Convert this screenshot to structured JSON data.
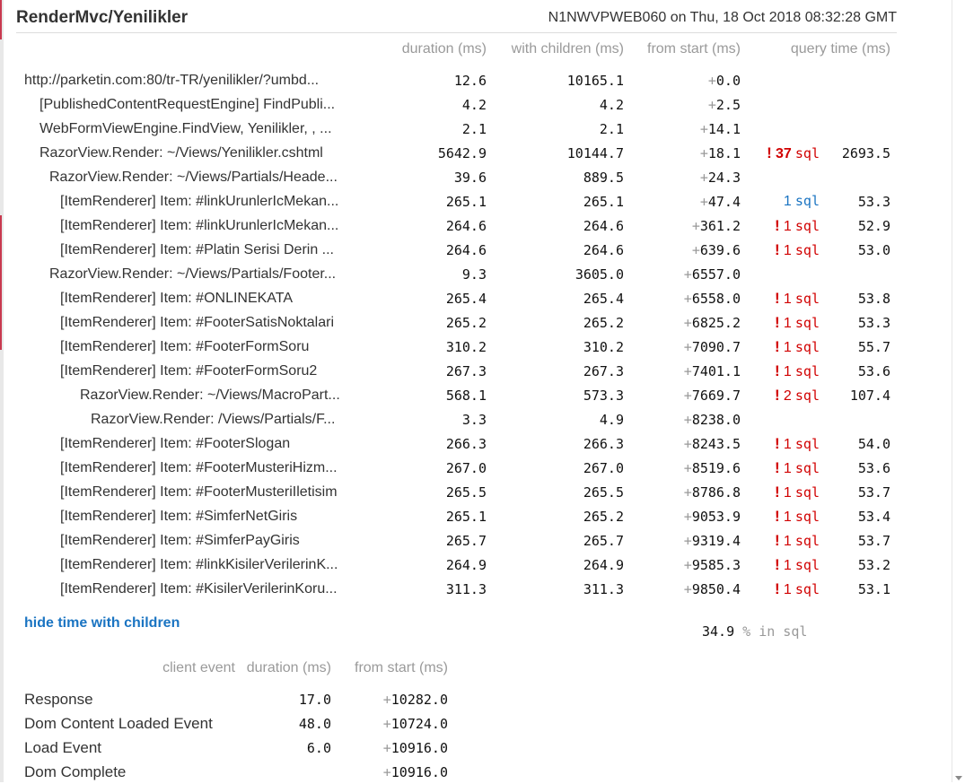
{
  "header": {
    "title": "RenderMvc/Yenilikler",
    "server_info": "N1NWVPWEB060 on Thu, 18 Oct 2018 08:32:28 GMT"
  },
  "timings": {
    "columns": {
      "duration": "duration (ms)",
      "with_children": "with children (ms)",
      "from_start": "from start (ms)",
      "query_time": "query time (ms)"
    },
    "rows": [
      {
        "label": "http://parketin.com:80/tr-TR/yenilikler/?umbd...",
        "indent": 0,
        "duration": "12.6",
        "with_children": "10165.1",
        "from_start": "0.0",
        "warn": "",
        "sql_count": "",
        "sql_word": "",
        "query_time": ""
      },
      {
        "label": "[PublishedContentRequestEngine] FindPubli...",
        "indent": 1,
        "duration": "4.2",
        "with_children": "4.2",
        "from_start": "2.5",
        "warn": "",
        "sql_count": "",
        "sql_word": "",
        "query_time": ""
      },
      {
        "label": "WebFormViewEngine.FindView, Yenilikler, , ...",
        "indent": 1,
        "duration": "2.1",
        "with_children": "2.1",
        "from_start": "14.1",
        "warn": "",
        "sql_count": "",
        "sql_word": "",
        "query_time": ""
      },
      {
        "label": "RazorView.Render: ~/Views/Yenilikler.cshtml",
        "indent": 1,
        "duration": "5642.9",
        "with_children": "10144.7",
        "from_start": "18.1",
        "warn": "!",
        "sql_count": "37",
        "sql_word": "sql",
        "query_time": "2693.5"
      },
      {
        "label": "RazorView.Render: ~/Views/Partials/Heade...",
        "indent": 2,
        "duration": "39.6",
        "with_children": "889.5",
        "from_start": "24.3",
        "warn": "",
        "sql_count": "",
        "sql_word": "",
        "query_time": ""
      },
      {
        "label": "[ItemRenderer] Item: #linkUrunlerIcMekan...",
        "indent": 3,
        "duration": "265.1",
        "with_children": "265.1",
        "from_start": "47.4",
        "warn": "",
        "sql_count": "1",
        "sql_word": "sql",
        "query_time": "53.3"
      },
      {
        "label": "[ItemRenderer] Item: #linkUrunlerIcMekan...",
        "indent": 3,
        "duration": "264.6",
        "with_children": "264.6",
        "from_start": "361.2",
        "warn": "!",
        "sql_count": "1",
        "sql_word": "sql",
        "query_time": "52.9"
      },
      {
        "label": "[ItemRenderer] Item: #Platin Serisi Derin ...",
        "indent": 3,
        "duration": "264.6",
        "with_children": "264.6",
        "from_start": "639.6",
        "warn": "!",
        "sql_count": "1",
        "sql_word": "sql",
        "query_time": "53.0"
      },
      {
        "label": "RazorView.Render: ~/Views/Partials/Footer...",
        "indent": 2,
        "duration": "9.3",
        "with_children": "3605.0",
        "from_start": "6557.0",
        "warn": "",
        "sql_count": "",
        "sql_word": "",
        "query_time": ""
      },
      {
        "label": "[ItemRenderer] Item: #ONLINEKATA",
        "indent": 3,
        "duration": "265.4",
        "with_children": "265.4",
        "from_start": "6558.0",
        "warn": "!",
        "sql_count": "1",
        "sql_word": "sql",
        "query_time": "53.8"
      },
      {
        "label": "[ItemRenderer] Item: #FooterSatisNoktalari",
        "indent": 3,
        "duration": "265.2",
        "with_children": "265.2",
        "from_start": "6825.2",
        "warn": "!",
        "sql_count": "1",
        "sql_word": "sql",
        "query_time": "53.3"
      },
      {
        "label": "[ItemRenderer] Item: #FooterFormSoru",
        "indent": 3,
        "duration": "310.2",
        "with_children": "310.2",
        "from_start": "7090.7",
        "warn": "!",
        "sql_count": "1",
        "sql_word": "sql",
        "query_time": "55.7"
      },
      {
        "label": "[ItemRenderer] Item: #FooterFormSoru2",
        "indent": 3,
        "duration": "267.3",
        "with_children": "267.3",
        "from_start": "7401.1",
        "warn": "!",
        "sql_count": "1",
        "sql_word": "sql",
        "query_time": "53.6"
      },
      {
        "label": "RazorView.Render: ~/Views/MacroPart...",
        "indent": 4,
        "duration": "568.1",
        "with_children": "573.3",
        "from_start": "7669.7",
        "warn": "!",
        "sql_count": "2",
        "sql_word": "sql",
        "query_time": "107.4"
      },
      {
        "label": "RazorView.Render: /Views/Partials/F...",
        "indent": 5,
        "duration": "3.3",
        "with_children": "4.9",
        "from_start": "8238.0",
        "warn": "",
        "sql_count": "",
        "sql_word": "",
        "query_time": ""
      },
      {
        "label": "[ItemRenderer] Item: #FooterSlogan",
        "indent": 3,
        "duration": "266.3",
        "with_children": "266.3",
        "from_start": "8243.5",
        "warn": "!",
        "sql_count": "1",
        "sql_word": "sql",
        "query_time": "54.0"
      },
      {
        "label": "[ItemRenderer] Item: #FooterMusteriHizm...",
        "indent": 3,
        "duration": "267.0",
        "with_children": "267.0",
        "from_start": "8519.6",
        "warn": "!",
        "sql_count": "1",
        "sql_word": "sql",
        "query_time": "53.6"
      },
      {
        "label": "[ItemRenderer] Item: #FooterMusteriIletisim",
        "indent": 3,
        "duration": "265.5",
        "with_children": "265.5",
        "from_start": "8786.8",
        "warn": "!",
        "sql_count": "1",
        "sql_word": "sql",
        "query_time": "53.7"
      },
      {
        "label": "[ItemRenderer] Item: #SimferNetGiris",
        "indent": 3,
        "duration": "265.1",
        "with_children": "265.2",
        "from_start": "9053.9",
        "warn": "!",
        "sql_count": "1",
        "sql_word": "sql",
        "query_time": "53.4"
      },
      {
        "label": "[ItemRenderer] Item: #SimferPayGiris",
        "indent": 3,
        "duration": "265.7",
        "with_children": "265.7",
        "from_start": "9319.4",
        "warn": "!",
        "sql_count": "1",
        "sql_word": "sql",
        "query_time": "53.7"
      },
      {
        "label": "[ItemRenderer] Item: #linkKisilerVerilerinK...",
        "indent": 3,
        "duration": "264.9",
        "with_children": "264.9",
        "from_start": "9585.3",
        "warn": "!",
        "sql_count": "1",
        "sql_word": "sql",
        "query_time": "53.2"
      },
      {
        "label": "[ItemRenderer] Item: #KisilerVerilerinKoru...",
        "indent": 3,
        "duration": "311.3",
        "with_children": "311.3",
        "from_start": "9850.4",
        "warn": "!",
        "sql_count": "1",
        "sql_word": "sql",
        "query_time": "53.1"
      }
    ],
    "plus_sign": "+",
    "toggle_link": "hide time with children",
    "sql_percent_value": "34.9",
    "sql_percent_label": "% in sql"
  },
  "client": {
    "columns": {
      "event": "client event",
      "duration": "duration (ms)",
      "from_start": "from start (ms)"
    },
    "rows": [
      {
        "label": "Response",
        "duration": "17.0",
        "from_start": "10282.0"
      },
      {
        "label": "Dom Content Loaded Event",
        "duration": "48.0",
        "from_start": "10724.0"
      },
      {
        "label": "Load Event",
        "duration": "6.0",
        "from_start": "10916.0"
      },
      {
        "label": "Dom Complete",
        "duration": "",
        "from_start": "10916.0"
      }
    ]
  },
  "colors": {
    "link": "#1a74c2",
    "warning": "#d10000",
    "muted": "#9a9a9a"
  },
  "icons": {
    "scroll_down": "triangle-down-icon"
  }
}
